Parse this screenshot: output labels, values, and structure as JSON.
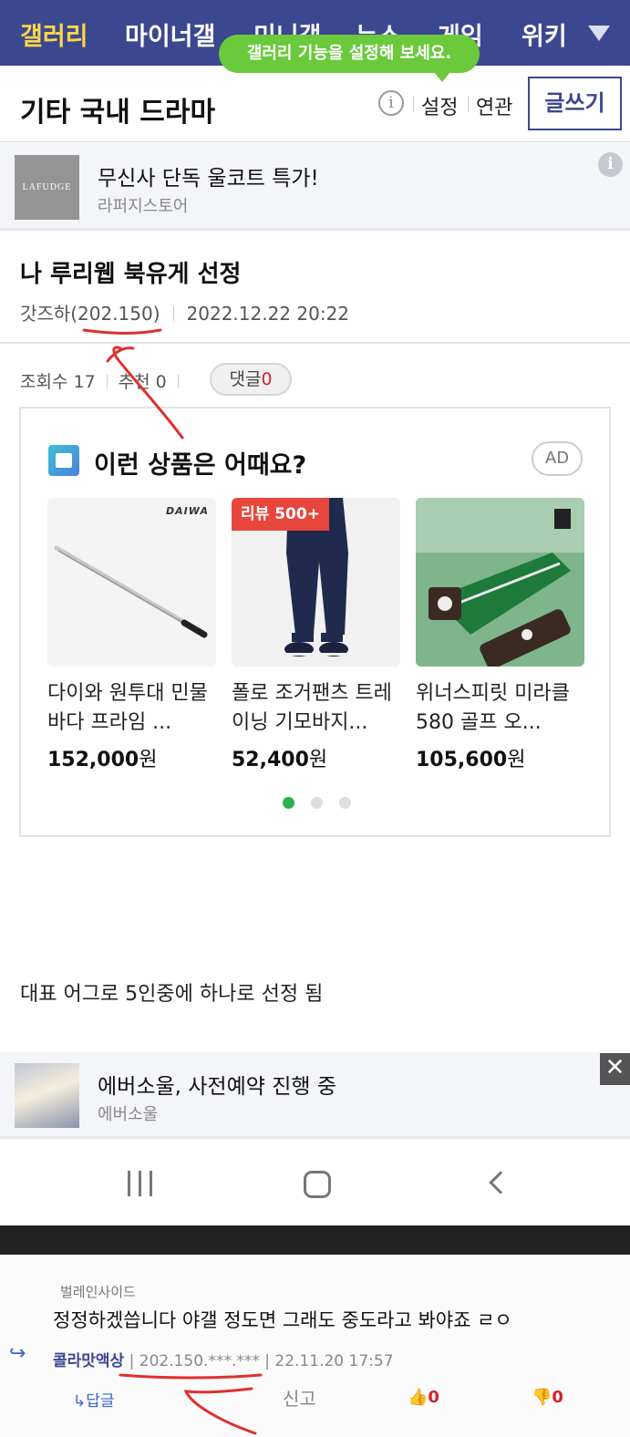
{
  "nav": {
    "items": [
      "갤러리",
      "마이너갤",
      "미니갤",
      "뉴스",
      "게임",
      "위키"
    ],
    "active_color": "#ffd648",
    "bg_color": "#3b4890"
  },
  "tooltip": "갤러리 기능을 설정해 보세요.",
  "header": {
    "title": "기타 국내 드라마",
    "info_icon": "i",
    "settings": "설정",
    "related": "연관",
    "write": "글쓰기"
  },
  "ad_top": {
    "logo_text": "LAFUDGE",
    "title": "무신사 단독 울코트 특가!",
    "advertiser": "라퍼지스토어",
    "info_icon": "i"
  },
  "post": {
    "title": "나 루리웹 북유게 선정",
    "author": "갓즈하",
    "ip": "(202.150)",
    "date": "2022.12.22 20:22",
    "views_label": "조회수 17",
    "recommend_label": "추천 0",
    "comments_label": "댓글",
    "comments_count": "0",
    "body": "대표 어그로 5인중에 하나로 선정 됨"
  },
  "recommend": {
    "title": "이런 상품은 어때요?",
    "ad_label": "AD",
    "products": [
      {
        "name": "다이와 원투대 민물 바다 프라임 ...",
        "price": "152,000",
        "currency": "원",
        "brand_mark": "DAIWA"
      },
      {
        "name": "폴로 조거팬츠 트레이닝 기모바지...",
        "price": "52,400",
        "currency": "원",
        "badge": "리뷰 500+"
      },
      {
        "name": "위너스피릿 미라클580 골프 오...",
        "price": "105,600",
        "currency": "원"
      }
    ],
    "page_count": 3,
    "active_page": 1
  },
  "ad_bottom": {
    "title": "에버소울, 사전예약 진행 중",
    "advertiser": "에버소울",
    "close_icon": "✕"
  },
  "comment": {
    "quoted_author": "벌레인사이드",
    "text": "정정하겠씁니다 야갤 정도면 그래도 중도라고 봐야죠 ㄹㅇ",
    "nickname": "콜라맛액상",
    "ip": "202.150.***.***",
    "date": "22.11.20 17:57",
    "reply_label": "↳답글",
    "report_label": "신고",
    "up_count": "0",
    "down_count": "0"
  }
}
